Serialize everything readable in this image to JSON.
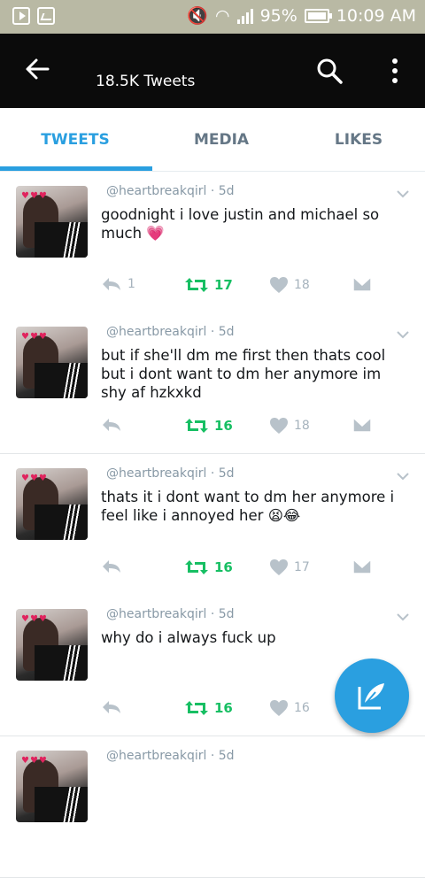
{
  "status_bar": {
    "battery": "95%",
    "time": "10:09 AM"
  },
  "app_bar": {
    "title": "18.5K Tweets"
  },
  "tabs": [
    {
      "label": "TWEETS",
      "active": true
    },
    {
      "label": "MEDIA",
      "active": false
    },
    {
      "label": "LIKES",
      "active": false
    }
  ],
  "tweets": [
    {
      "handle": "@heartbreakqirl",
      "time": "5d",
      "text": "goodnight i love justin and michael so much 💗",
      "replies": "1",
      "retweets": "17",
      "likes": "18"
    },
    {
      "handle": "@heartbreakqirl",
      "time": "5d",
      "text": "but if she'll dm me first then thats cool but i dont want to dm her anymore im shy af hzkxkd",
      "replies": "",
      "retweets": "16",
      "likes": "18"
    },
    {
      "handle": "@heartbreakqirl",
      "time": "5d",
      "text": "thats it i dont want to dm her anymore i feel like i annoyed her 😫😂",
      "replies": "",
      "retweets": "16",
      "likes": "17"
    },
    {
      "handle": "@heartbreakqirl",
      "time": "5d",
      "text": "why do i always fuck up",
      "replies": "",
      "retweets": "16",
      "likes": "16"
    },
    {
      "handle": "@heartbreakqirl",
      "time": "5d",
      "text": "",
      "replies": "",
      "retweets": "",
      "likes": ""
    }
  ],
  "colors": {
    "accent": "#2a9fe0",
    "retweet": "#17bf63",
    "status_bar": "#b9b9a4",
    "app_bar": "#0b0b0b"
  },
  "icons": [
    "back-arrow-icon",
    "search-icon",
    "more-vert-icon",
    "reply-icon",
    "retweet-icon",
    "heart-icon",
    "direct-message-icon",
    "compose-tweet-icon"
  ]
}
